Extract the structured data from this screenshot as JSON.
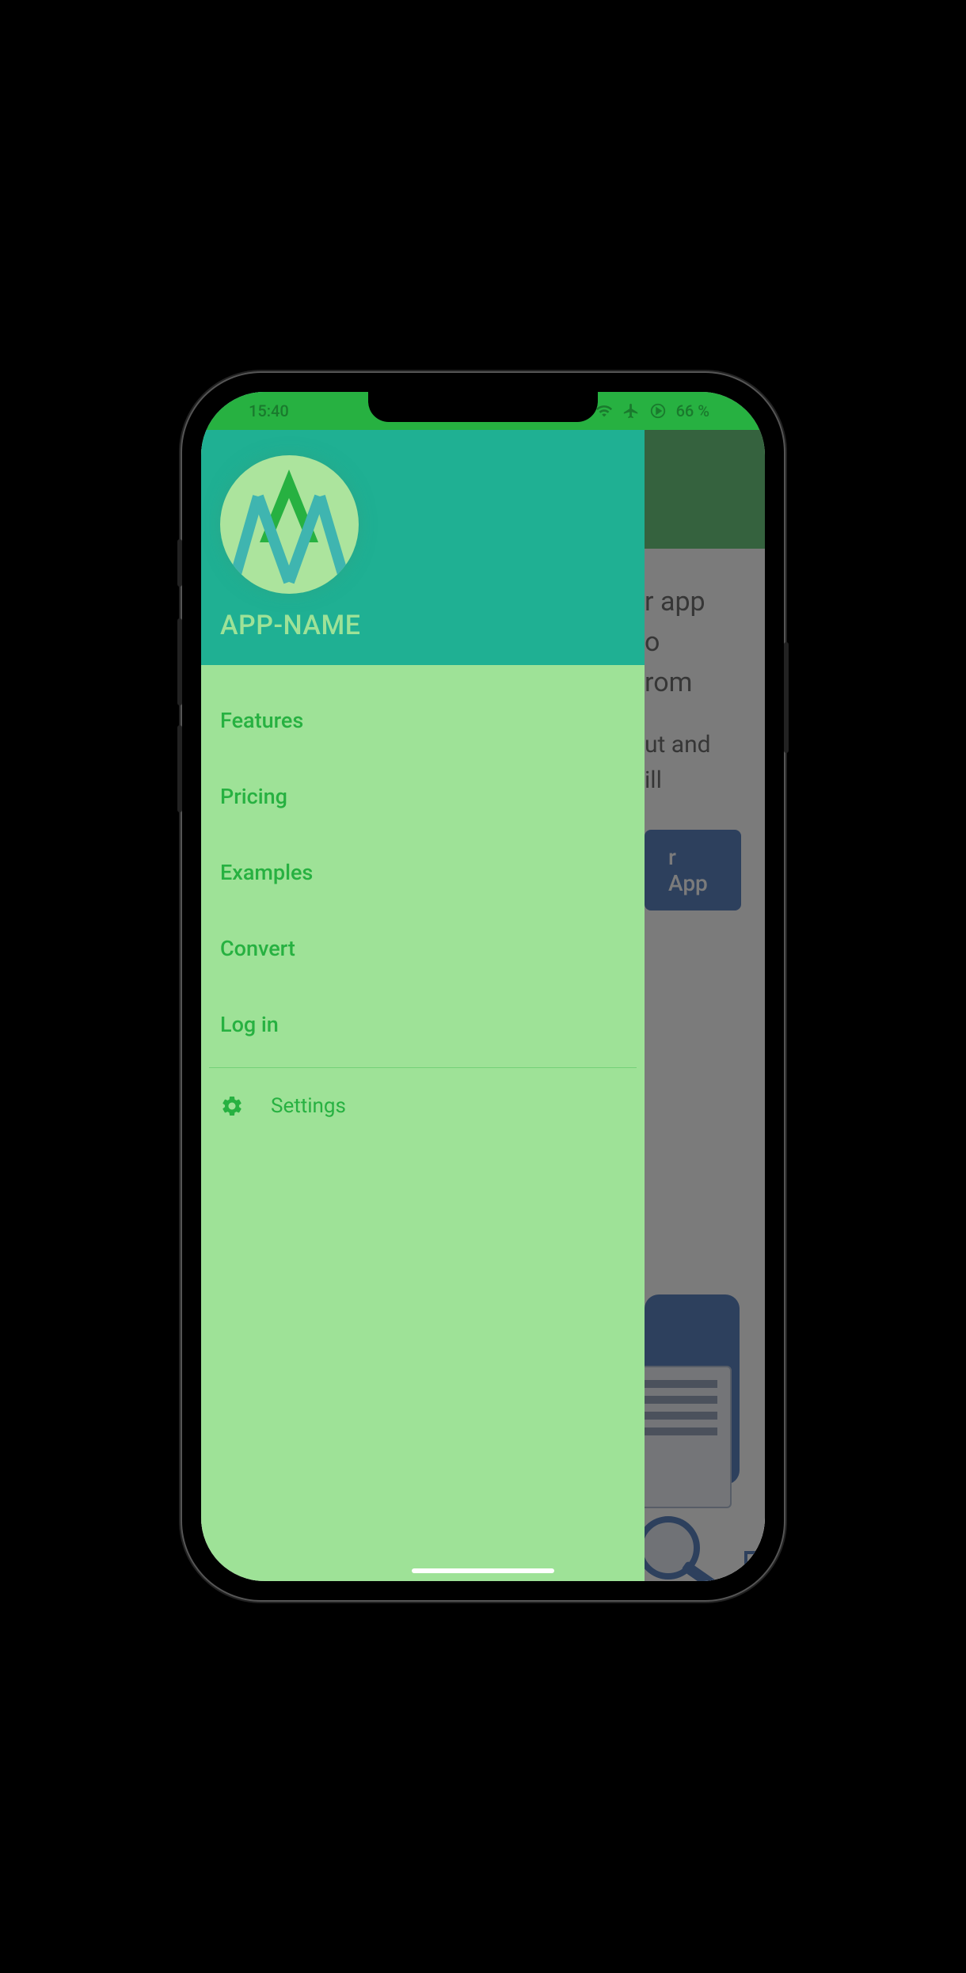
{
  "status": {
    "time": "15:40",
    "battery": "66 %"
  },
  "drawer": {
    "app_name": "APP-NAME",
    "items": [
      {
        "label": "Features"
      },
      {
        "label": "Pricing"
      },
      {
        "label": "Examples"
      },
      {
        "label": "Convert"
      },
      {
        "label": "Log in"
      }
    ],
    "settings_label": "Settings"
  },
  "main": {
    "heading_fragment": "r app\no\nrom",
    "sub_fragment": "ut and\nill",
    "cta_fragment": "r App"
  }
}
